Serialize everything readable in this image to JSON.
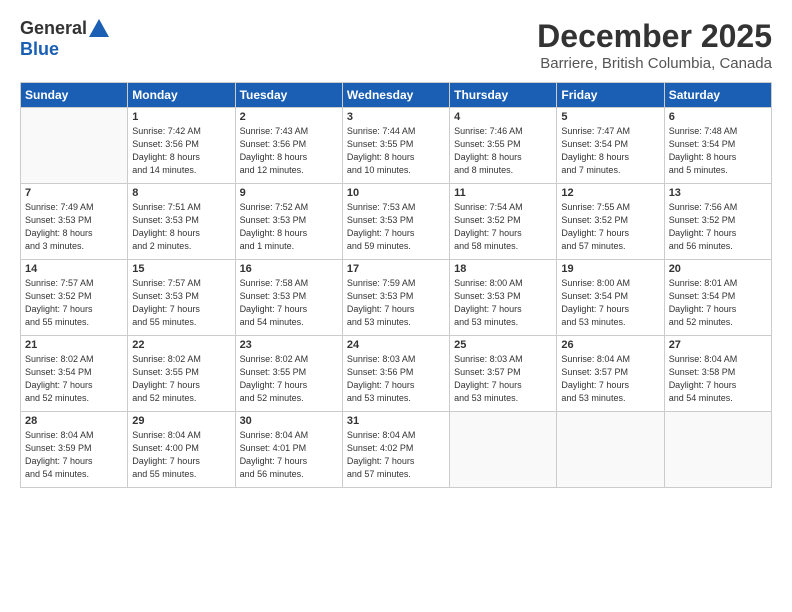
{
  "logo": {
    "general": "General",
    "blue": "Blue"
  },
  "title": "December 2025",
  "subtitle": "Barriere, British Columbia, Canada",
  "days_of_week": [
    "Sunday",
    "Monday",
    "Tuesday",
    "Wednesday",
    "Thursday",
    "Friday",
    "Saturday"
  ],
  "weeks": [
    [
      {
        "day": "",
        "info": ""
      },
      {
        "day": "1",
        "info": "Sunrise: 7:42 AM\nSunset: 3:56 PM\nDaylight: 8 hours\nand 14 minutes."
      },
      {
        "day": "2",
        "info": "Sunrise: 7:43 AM\nSunset: 3:56 PM\nDaylight: 8 hours\nand 12 minutes."
      },
      {
        "day": "3",
        "info": "Sunrise: 7:44 AM\nSunset: 3:55 PM\nDaylight: 8 hours\nand 10 minutes."
      },
      {
        "day": "4",
        "info": "Sunrise: 7:46 AM\nSunset: 3:55 PM\nDaylight: 8 hours\nand 8 minutes."
      },
      {
        "day": "5",
        "info": "Sunrise: 7:47 AM\nSunset: 3:54 PM\nDaylight: 8 hours\nand 7 minutes."
      },
      {
        "day": "6",
        "info": "Sunrise: 7:48 AM\nSunset: 3:54 PM\nDaylight: 8 hours\nand 5 minutes."
      }
    ],
    [
      {
        "day": "7",
        "info": "Sunrise: 7:49 AM\nSunset: 3:53 PM\nDaylight: 8 hours\nand 3 minutes."
      },
      {
        "day": "8",
        "info": "Sunrise: 7:51 AM\nSunset: 3:53 PM\nDaylight: 8 hours\nand 2 minutes."
      },
      {
        "day": "9",
        "info": "Sunrise: 7:52 AM\nSunset: 3:53 PM\nDaylight: 8 hours\nand 1 minute."
      },
      {
        "day": "10",
        "info": "Sunrise: 7:53 AM\nSunset: 3:53 PM\nDaylight: 7 hours\nand 59 minutes."
      },
      {
        "day": "11",
        "info": "Sunrise: 7:54 AM\nSunset: 3:52 PM\nDaylight: 7 hours\nand 58 minutes."
      },
      {
        "day": "12",
        "info": "Sunrise: 7:55 AM\nSunset: 3:52 PM\nDaylight: 7 hours\nand 57 minutes."
      },
      {
        "day": "13",
        "info": "Sunrise: 7:56 AM\nSunset: 3:52 PM\nDaylight: 7 hours\nand 56 minutes."
      }
    ],
    [
      {
        "day": "14",
        "info": "Sunrise: 7:57 AM\nSunset: 3:52 PM\nDaylight: 7 hours\nand 55 minutes."
      },
      {
        "day": "15",
        "info": "Sunrise: 7:57 AM\nSunset: 3:53 PM\nDaylight: 7 hours\nand 55 minutes."
      },
      {
        "day": "16",
        "info": "Sunrise: 7:58 AM\nSunset: 3:53 PM\nDaylight: 7 hours\nand 54 minutes."
      },
      {
        "day": "17",
        "info": "Sunrise: 7:59 AM\nSunset: 3:53 PM\nDaylight: 7 hours\nand 53 minutes."
      },
      {
        "day": "18",
        "info": "Sunrise: 8:00 AM\nSunset: 3:53 PM\nDaylight: 7 hours\nand 53 minutes."
      },
      {
        "day": "19",
        "info": "Sunrise: 8:00 AM\nSunset: 3:54 PM\nDaylight: 7 hours\nand 53 minutes."
      },
      {
        "day": "20",
        "info": "Sunrise: 8:01 AM\nSunset: 3:54 PM\nDaylight: 7 hours\nand 52 minutes."
      }
    ],
    [
      {
        "day": "21",
        "info": "Sunrise: 8:02 AM\nSunset: 3:54 PM\nDaylight: 7 hours\nand 52 minutes."
      },
      {
        "day": "22",
        "info": "Sunrise: 8:02 AM\nSunset: 3:55 PM\nDaylight: 7 hours\nand 52 minutes."
      },
      {
        "day": "23",
        "info": "Sunrise: 8:02 AM\nSunset: 3:55 PM\nDaylight: 7 hours\nand 52 minutes."
      },
      {
        "day": "24",
        "info": "Sunrise: 8:03 AM\nSunset: 3:56 PM\nDaylight: 7 hours\nand 53 minutes."
      },
      {
        "day": "25",
        "info": "Sunrise: 8:03 AM\nSunset: 3:57 PM\nDaylight: 7 hours\nand 53 minutes."
      },
      {
        "day": "26",
        "info": "Sunrise: 8:04 AM\nSunset: 3:57 PM\nDaylight: 7 hours\nand 53 minutes."
      },
      {
        "day": "27",
        "info": "Sunrise: 8:04 AM\nSunset: 3:58 PM\nDaylight: 7 hours\nand 54 minutes."
      }
    ],
    [
      {
        "day": "28",
        "info": "Sunrise: 8:04 AM\nSunset: 3:59 PM\nDaylight: 7 hours\nand 54 minutes."
      },
      {
        "day": "29",
        "info": "Sunrise: 8:04 AM\nSunset: 4:00 PM\nDaylight: 7 hours\nand 55 minutes."
      },
      {
        "day": "30",
        "info": "Sunrise: 8:04 AM\nSunset: 4:01 PM\nDaylight: 7 hours\nand 56 minutes."
      },
      {
        "day": "31",
        "info": "Sunrise: 8:04 AM\nSunset: 4:02 PM\nDaylight: 7 hours\nand 57 minutes."
      },
      {
        "day": "",
        "info": ""
      },
      {
        "day": "",
        "info": ""
      },
      {
        "day": "",
        "info": ""
      }
    ]
  ]
}
